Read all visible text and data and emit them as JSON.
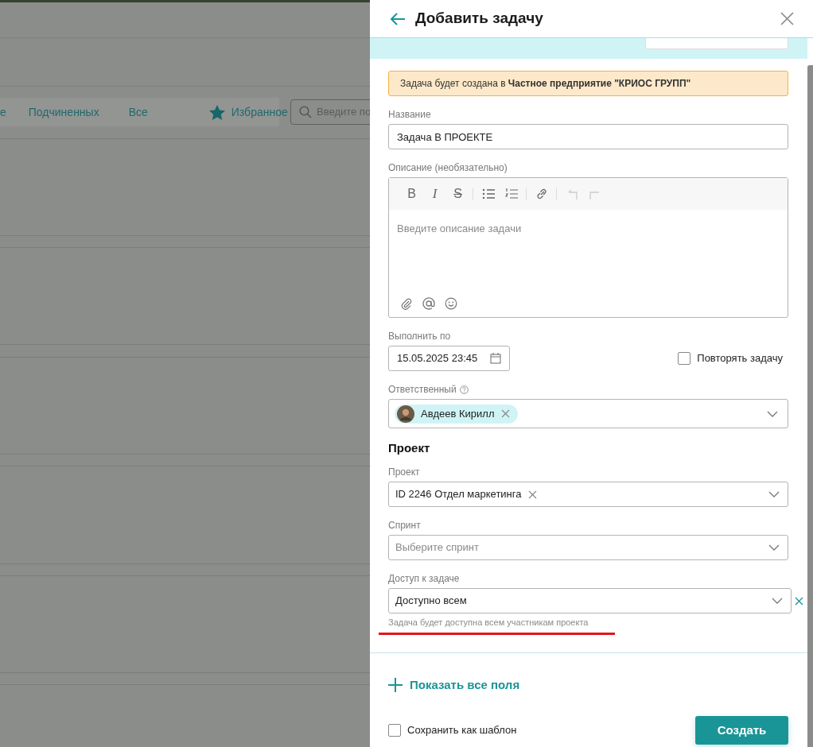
{
  "background": {
    "filters": [
      {
        "label": "е"
      },
      {
        "label": "Подчиненных"
      },
      {
        "label": "Все"
      }
    ],
    "favorites": "Избранное",
    "search": {
      "placeholder": "Введите по"
    }
  },
  "dialog": {
    "title": "Добавить задачу",
    "notice": "Задача будет создана в **Частное предприятие \"КРИОС ГРУПП\"**",
    "name_field": {
      "label": "Название",
      "value": "Задача В ПРОЕКТЕ"
    },
    "description": {
      "label": "Описание (необязательно)",
      "placeholder": "Введите описание задачи",
      "toolbar": [
        [
          {
            "kind": "bold",
            "label": "B",
            "disabled": false
          },
          {
            "kind": "italic",
            "label": "I",
            "disabled": false
          },
          {
            "kind": "strike",
            "label": "S",
            "disabled": false
          }
        ],
        [
          {
            "kind": "bullet_list",
            "disabled": false
          },
          {
            "kind": "numbered_list",
            "disabled": false
          }
        ],
        [
          {
            "kind": "link",
            "disabled": false
          }
        ],
        [
          {
            "kind": "undo",
            "disabled": true
          },
          {
            "kind": "redo",
            "disabled": true
          }
        ]
      ],
      "footer": [
        {
          "kind": "attach"
        },
        {
          "kind": "mention"
        },
        {
          "kind": "emoji"
        }
      ]
    },
    "due": {
      "label": "Выполнить по",
      "value": "15.05.2025 23:45"
    },
    "repeat": {
      "label": "Повторять задачу",
      "checked": false
    },
    "assignee": {
      "label": "Ответственный",
      "chips": [
        {
          "name": "Авдеев Кирилл"
        }
      ]
    },
    "section_title": "Проект",
    "selects": [
      {
        "kind": "inline_clear",
        "label": "Проект",
        "value": "ID 2246 Отдел маркетинга"
      },
      {
        "kind": "plain",
        "label": "Спринт",
        "placeholder": "Выберите спринт"
      },
      {
        "kind": "outside_clear",
        "label": "Доступ к задаче",
        "value": "Доступно всем",
        "hint": "Задача будет доступна всем участникам проекта"
      }
    ],
    "show_all": "Показать все поля",
    "save_template": {
      "label": "Сохранить как шаблон",
      "checked": false
    },
    "submit": "Создать"
  }
}
